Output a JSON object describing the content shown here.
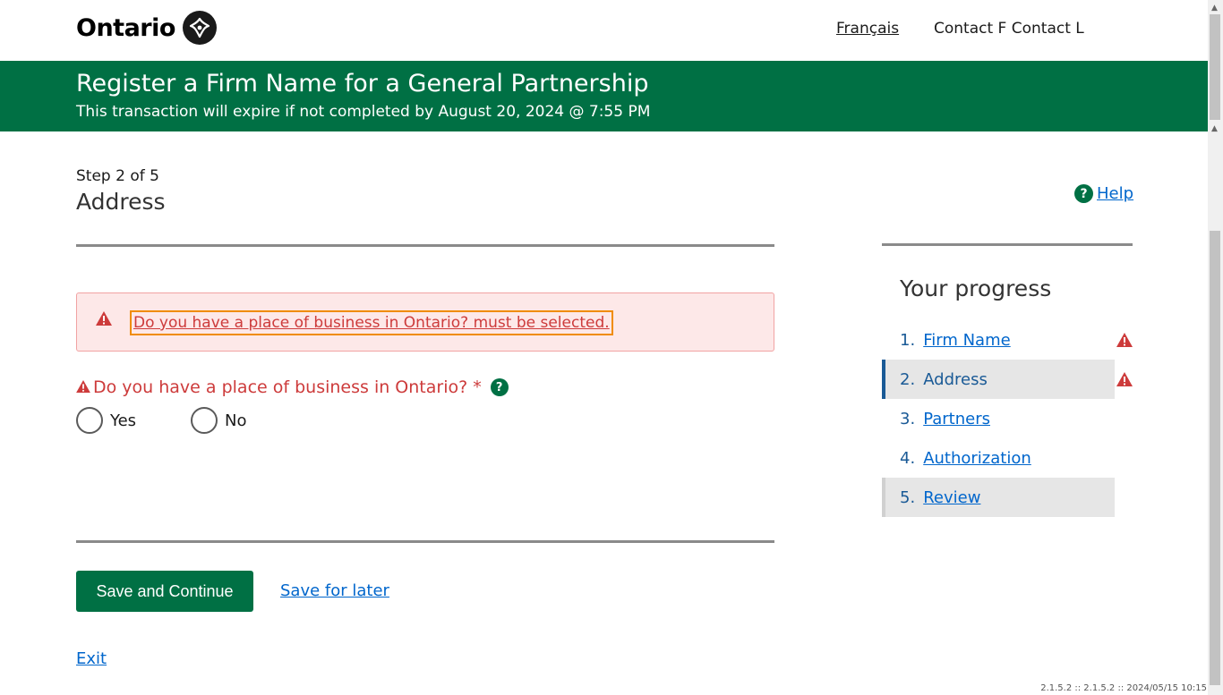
{
  "header": {
    "logo_text": "Ontario",
    "language_link": "Français",
    "user_name": "Contact F Contact L"
  },
  "banner": {
    "title": "Register a Firm Name for a General Partnership",
    "subtitle": "This transaction will expire if not completed by August 20, 2024 @ 7:55 PM"
  },
  "page": {
    "step_label": "Step 2 of 5",
    "title": "Address",
    "help_label": "Help"
  },
  "error": {
    "message": "Do you have a place of business in Ontario? must be selected."
  },
  "question": {
    "label": "Do you have a place of business in Ontario?",
    "required_marker": "*",
    "options": [
      "Yes",
      "No"
    ]
  },
  "actions": {
    "save_continue": "Save and Continue",
    "save_later": "Save for later",
    "exit": "Exit"
  },
  "progress": {
    "title": "Your progress",
    "items": [
      {
        "num": "1.",
        "label": "Firm Name"
      },
      {
        "num": "2.",
        "label": "Address"
      },
      {
        "num": "3.",
        "label": "Partners"
      },
      {
        "num": "4.",
        "label": "Authorization"
      },
      {
        "num": "5.",
        "label": "Review"
      }
    ]
  },
  "footer": {
    "version": "2.1.5.2 :: 2.1.5.2 :: 2024/05/15 10:15"
  },
  "colors": {
    "brand_green": "#007044",
    "error_red": "#cd3b3b",
    "link_blue": "#0066cc"
  }
}
